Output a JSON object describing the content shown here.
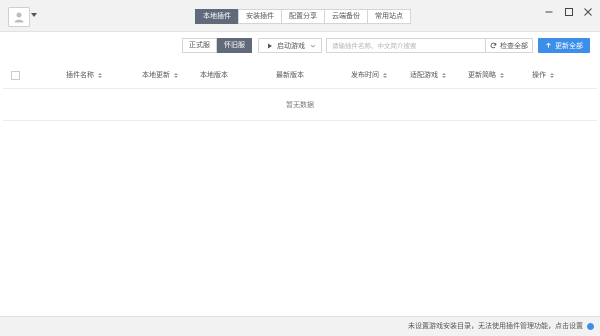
{
  "header": {
    "tabs": [
      {
        "label": "本地插件",
        "active": true
      },
      {
        "label": "安装插件",
        "active": false
      },
      {
        "label": "配置分享",
        "active": false
      },
      {
        "label": "云端备份",
        "active": false
      },
      {
        "label": "常用站点",
        "active": false
      }
    ]
  },
  "toolbar": {
    "versions": [
      {
        "label": "正式服",
        "active": false
      },
      {
        "label": "怀旧服",
        "active": true
      }
    ],
    "launch_label": "启动游戏",
    "search_placeholder": "请输插件名称、中文简介搜索",
    "check_all_label": "检查全部",
    "update_all_label": "更新全部"
  },
  "table": {
    "columns": [
      "插件名称",
      "本地更新",
      "本地版本",
      "最新版本",
      "发布时间",
      "适配游戏",
      "更新简略",
      "操作"
    ],
    "empty_text": "暂无数据"
  },
  "status": {
    "message": "未设置游戏安装目录，无法使用插件管理功能，点击设置"
  },
  "colors": {
    "accent": "#3d8ee8",
    "tab_active": "#606a7a",
    "chrome": "#f2f2f2"
  }
}
